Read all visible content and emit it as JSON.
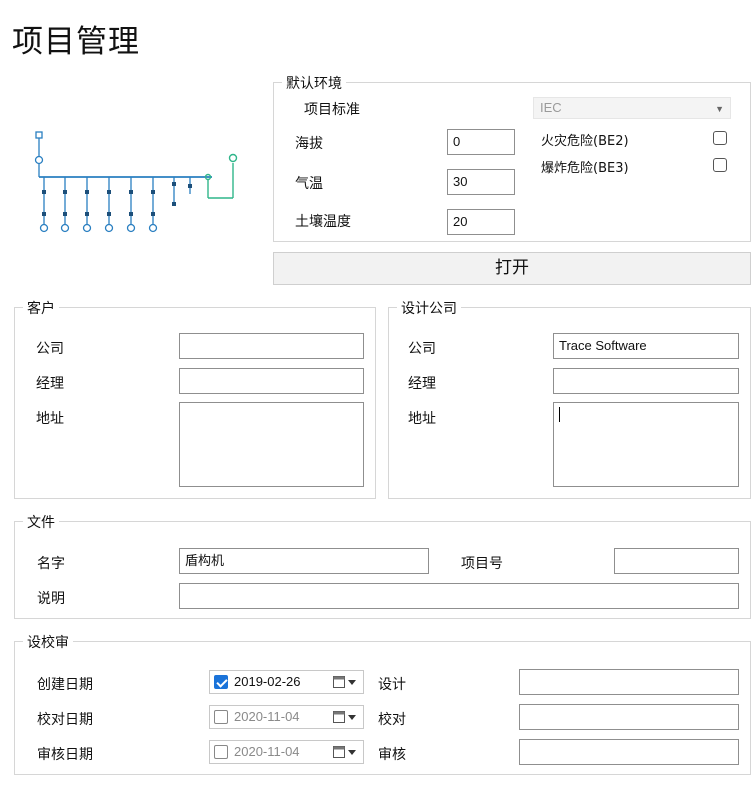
{
  "page_title": "项目管理",
  "env": {
    "legend": "默认环境",
    "standard_label": "项目标准",
    "standard_value": "IEC",
    "altitude_label": "海拔",
    "altitude_value": "0",
    "temperature_label": "气温",
    "temperature_value": "30",
    "soil_temp_label": "土壤温度",
    "soil_temp_value": "20",
    "fire_label": "火灾危险(BE2)",
    "explosion_label": "爆炸危险(BE3)"
  },
  "open_button": "打开",
  "client": {
    "legend": "客户",
    "company_label": "公司",
    "company_value": "",
    "manager_label": "经理",
    "manager_value": "",
    "address_label": "地址",
    "address_value": ""
  },
  "design_company": {
    "legend": "设计公司",
    "company_label": "公司",
    "company_value": "Trace Software",
    "manager_label": "经理",
    "manager_value": "",
    "address_label": "地址",
    "address_value": ""
  },
  "file": {
    "legend": "文件",
    "name_label": "名字",
    "name_value": "盾构机",
    "project_no_label": "项目号",
    "project_no_value": "",
    "description_label": "说明",
    "description_value": ""
  },
  "review": {
    "legend": "设校审",
    "created_label": "创建日期",
    "created_date": "2019-02-26",
    "checked_label": "校对日期",
    "checked_date": "2020-11-04",
    "audit_label": "审核日期",
    "audit_date": "2020-11-04",
    "design_label": "设计",
    "design_value": "",
    "proof_label": "校对",
    "proof_value": "",
    "approve_label": "审核",
    "approve_value": ""
  },
  "colors": {
    "diagram_blue": "#2a7fc1",
    "diagram_green": "#2fb58a",
    "checkbox_on": "#1a73d9"
  }
}
